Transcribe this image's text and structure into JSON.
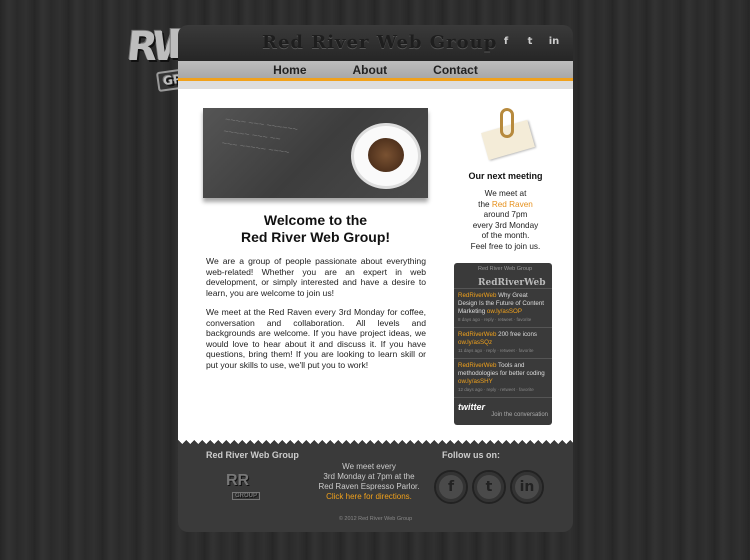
{
  "logo": {
    "letters_left": "RW",
    "letters_right": "R",
    "group": "GROUP"
  },
  "header": {
    "title": "Red River Web Group",
    "social": [
      "f",
      "t",
      "in"
    ]
  },
  "nav": [
    "Home",
    "About",
    "Contact"
  ],
  "main": {
    "welcome_line1": "Welcome to the",
    "welcome_line2": "Red River Web Group!",
    "paragraph1": "We are a group of people passionate about everything web-related! Whether you are an expert in web development, or simply interested and have a desire to learn, you are welcome to join us!",
    "paragraph2": "We meet at the Red Raven every 3rd Monday for coffee, conversation and collaboration. All levels and backgrounds are welcome. If you have project ideas, we would love to hear about it and discuss it. If you have questions, bring them! If you are looking to learn skill or put your skills to use, we'll put you to work!"
  },
  "sidebar": {
    "meeting_title": "Our next meeting",
    "meeting_line1": "We meet at",
    "meeting_line2_pre": "the",
    "meeting_place": "Red Raven",
    "meeting_line3": "around 7pm",
    "meeting_line4": "every 3rd Monday",
    "meeting_line5": "of the month.",
    "meeting_line6": "Feel free to join us."
  },
  "twitter": {
    "header_sub": "Red River Web Group",
    "header_main": "RedRiverWeb",
    "tweets": [
      {
        "user": "RedRiverWeb",
        "text": "Why Great Design Is the Future of Content Marketing",
        "link": "ow.ly/asSOP",
        "meta": "8 days ago · reply · retweet · favorite"
      },
      {
        "user": "RedRiverWeb",
        "text": "200 free icons",
        "link": "ow.ly/asSQz",
        "meta": "11 days ago · reply · retweet · favorite"
      },
      {
        "user": "RedRiverWeb",
        "text": "Tools and methodologies for better coding",
        "link": "ow.ly/asSHY",
        "meta": "12 days ago · reply · retweet · favorite"
      }
    ],
    "brand": "twitter",
    "join": "Join the conversation"
  },
  "footer": {
    "title": "Red River Web Group",
    "logo_text": "RR",
    "logo_group": "GROUP",
    "meet_line1": "We meet every",
    "meet_line2": "3rd Monday at 7pm at the",
    "meet_line3": "Red Raven Espresso Parlor.",
    "directions": "Click here for directions.",
    "follow": "Follow us on:",
    "icons": [
      "f",
      "t",
      "in"
    ],
    "copyright": "© 2012 Red River Web Group"
  },
  "colors": {
    "accent": "#f0a11c",
    "background": "#2e2e2e"
  }
}
